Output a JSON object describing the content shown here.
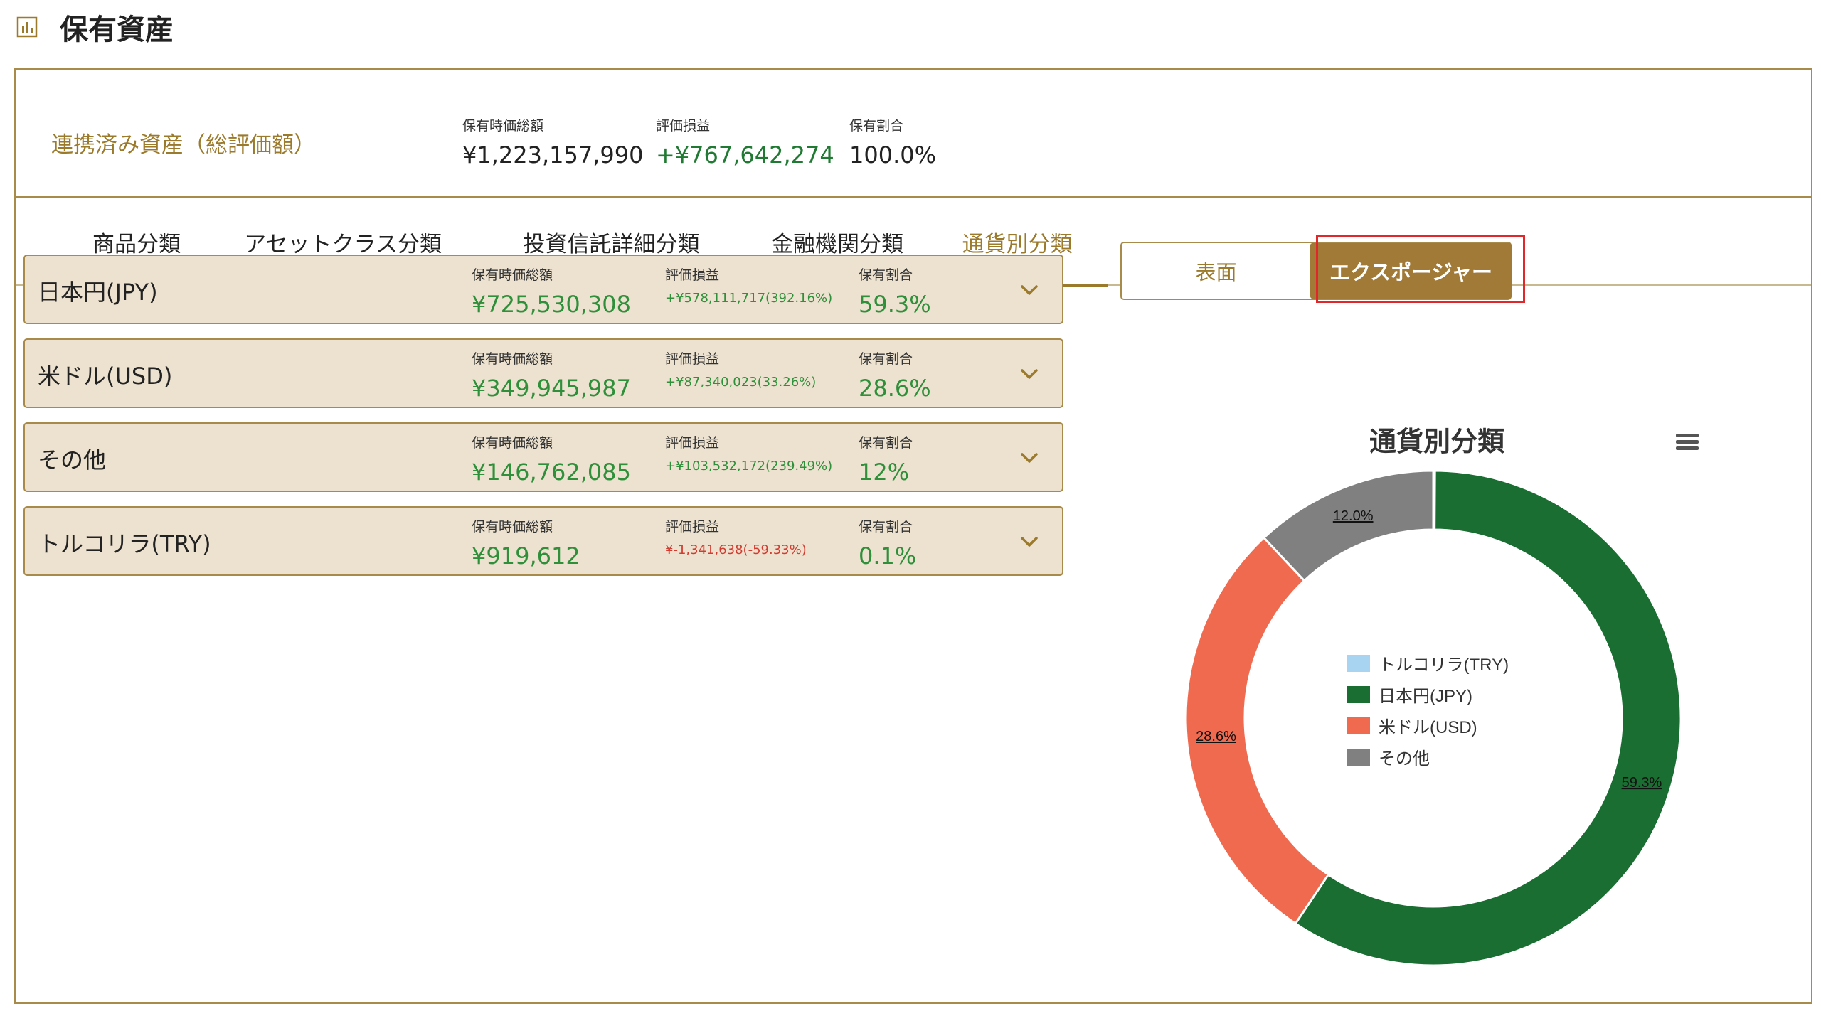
{
  "header": {
    "title": "保有資産",
    "icon": "bar-chart-icon"
  },
  "summary": {
    "label": "連携済み資産（総評価額）",
    "metrics": [
      {
        "label": "保有時価総額",
        "value": "¥1,223,157,990"
      },
      {
        "label": "評価損益",
        "value": "+¥767,642,274"
      },
      {
        "label": "保有割合",
        "value": "100.0%"
      }
    ]
  },
  "tabs": [
    "商品分類",
    "アセットクラス分類",
    "投資信託詳細分類",
    "金融機関分類",
    "通貨別分類"
  ],
  "active_tab": 4,
  "rows": [
    {
      "name": "日本円(JPY)",
      "labels": [
        "保有時価総額",
        "評価損益",
        "保有割合"
      ],
      "value": "¥725,530,308",
      "pl": "+¥578,111,717(392.16%)",
      "share": "59.3%"
    },
    {
      "name": "米ドル(USD)",
      "labels": [
        "保有時価総額",
        "評価損益",
        "保有割合"
      ],
      "value": "¥349,945,987",
      "pl": "+¥87,340,023(33.26%)",
      "share": "28.6%"
    },
    {
      "name": "その他",
      "labels": [
        "保有時価総額",
        "評価損益",
        "保有割合"
      ],
      "value": "¥146,762,085",
      "pl": "+¥103,532,172(239.49%)",
      "share": "12%"
    },
    {
      "name": "トルコリラ(TRY)",
      "labels": [
        "保有時価総額",
        "評価損益",
        "保有割合"
      ],
      "value": "¥919,612",
      "pl": "¥-1,341,638(-59.33%)",
      "share": "0.1%"
    }
  ],
  "toggle": {
    "surface": "表面",
    "exposure": "エクスポージャー",
    "selected": "exposure"
  },
  "colors": {
    "accent": "#9c7a2c",
    "positive": "#2f8f3a",
    "negative": "#d23b2f"
  },
  "chart_data": {
    "type": "pie",
    "title": "通貨別分類",
    "donut": true,
    "legend_position": "center",
    "series": [
      {
        "name": "トルコリラ(TRY)",
        "value": 0.1,
        "label": "0.1%",
        "color": "#a8d4f2"
      },
      {
        "name": "日本円(JPY)",
        "value": 59.3,
        "label": "59.3%",
        "color": "#1a6e32"
      },
      {
        "name": "米ドル(USD)",
        "value": 28.6,
        "label": "28.6%",
        "color": "#f06a50"
      },
      {
        "name": "その他",
        "value": 12.0,
        "label": "12.0%",
        "color": "#808080"
      }
    ]
  }
}
